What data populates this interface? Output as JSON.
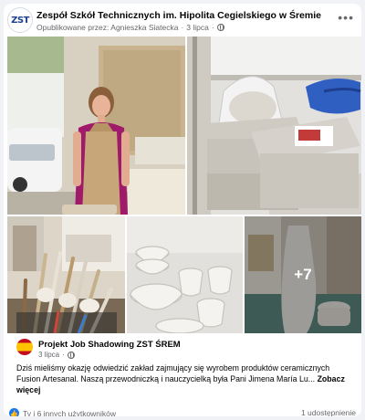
{
  "post": {
    "page_name": "Zespół Szkół Technicznych im. Hipolita Cegielskiego w Śremie",
    "avatar_text": "ZST",
    "meta_prefix": "Opublikowane przez: Agnieszka Siatecka",
    "sep": "·",
    "date": "3 lipca",
    "more_glyph": "•••"
  },
  "photos": {
    "more_count": "+7"
  },
  "shared": {
    "name": "Projekt Job Shadowing ZST ŚREM",
    "date": "3 lipca",
    "sep": "·",
    "text": "Dziś mieliśmy okazję odwiedzić zakład zajmujący się wyrobem produktów ceramicznych Fusion Artesanal. Naszą przewodniczką i nauczycielką była Pani Jimena María Lu...",
    "see_more": "Zobacz więcej"
  },
  "footer": {
    "reactions": "Ty i 6 innych użytkowników",
    "shares": "1 udostępnienie",
    "like_icon": "👍"
  }
}
